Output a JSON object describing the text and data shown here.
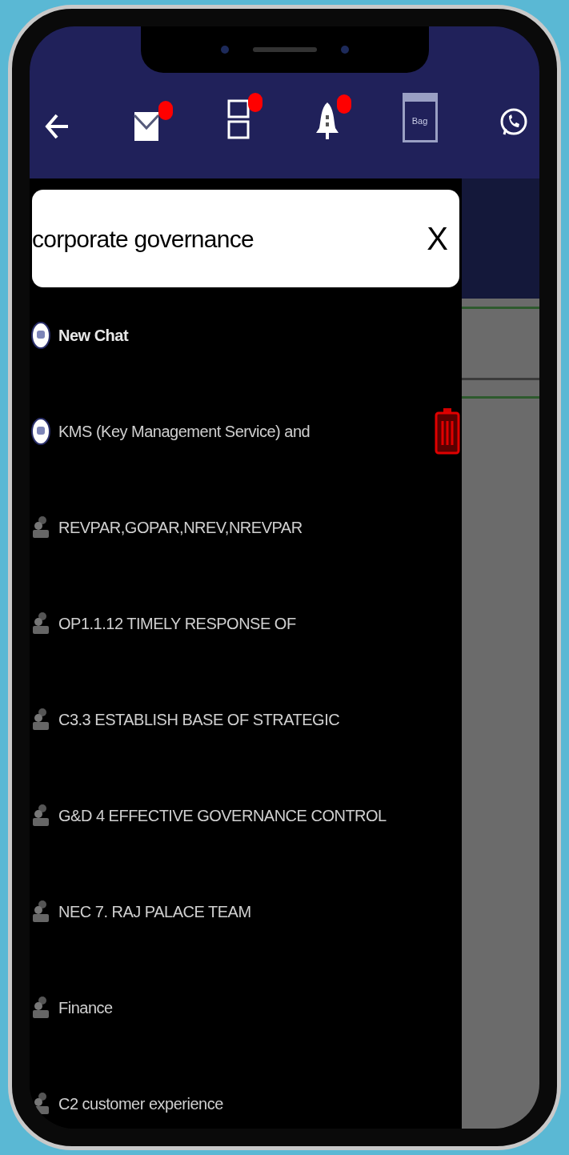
{
  "header": {
    "icons": [
      {
        "kind": "back",
        "badge": false
      },
      {
        "kind": "mail",
        "badge": true
      },
      {
        "kind": "layout",
        "badge": true
      },
      {
        "kind": "bell",
        "badge": true
      },
      {
        "kind": "bag",
        "badge": false,
        "label": "Bag"
      },
      {
        "kind": "whatsapp",
        "badge": false
      }
    ]
  },
  "search": {
    "value": "corporate governance",
    "clear": "X"
  },
  "chats": [
    {
      "kind": "bot",
      "title": "New Chat",
      "bold": true,
      "delete": false
    },
    {
      "kind": "bot",
      "title": "KMS (Key Management Service) and",
      "bold": false,
      "delete": true
    },
    {
      "kind": "group",
      "title": "REVPAR,GOPAR,NREV,NREVPAR",
      "bold": false,
      "delete": false
    },
    {
      "kind": "group",
      "title": "OP1.1.12 TIMELY RESPONSE OF",
      "bold": false,
      "delete": false
    },
    {
      "kind": "group",
      "title": "C3.3 ESTABLISH BASE OF STRATEGIC",
      "bold": false,
      "delete": false
    },
    {
      "kind": "group",
      "title": "G&D 4 EFFECTIVE GOVERNANCE CONTROL",
      "bold": false,
      "delete": false
    },
    {
      "kind": "group",
      "title": "NEC 7. RAJ PALACE TEAM",
      "bold": false,
      "delete": false
    },
    {
      "kind": "group",
      "title": "Finance",
      "bold": false,
      "delete": false
    },
    {
      "kind": "group",
      "title": "C2 customer experience",
      "bold": false,
      "delete": false
    }
  ]
}
